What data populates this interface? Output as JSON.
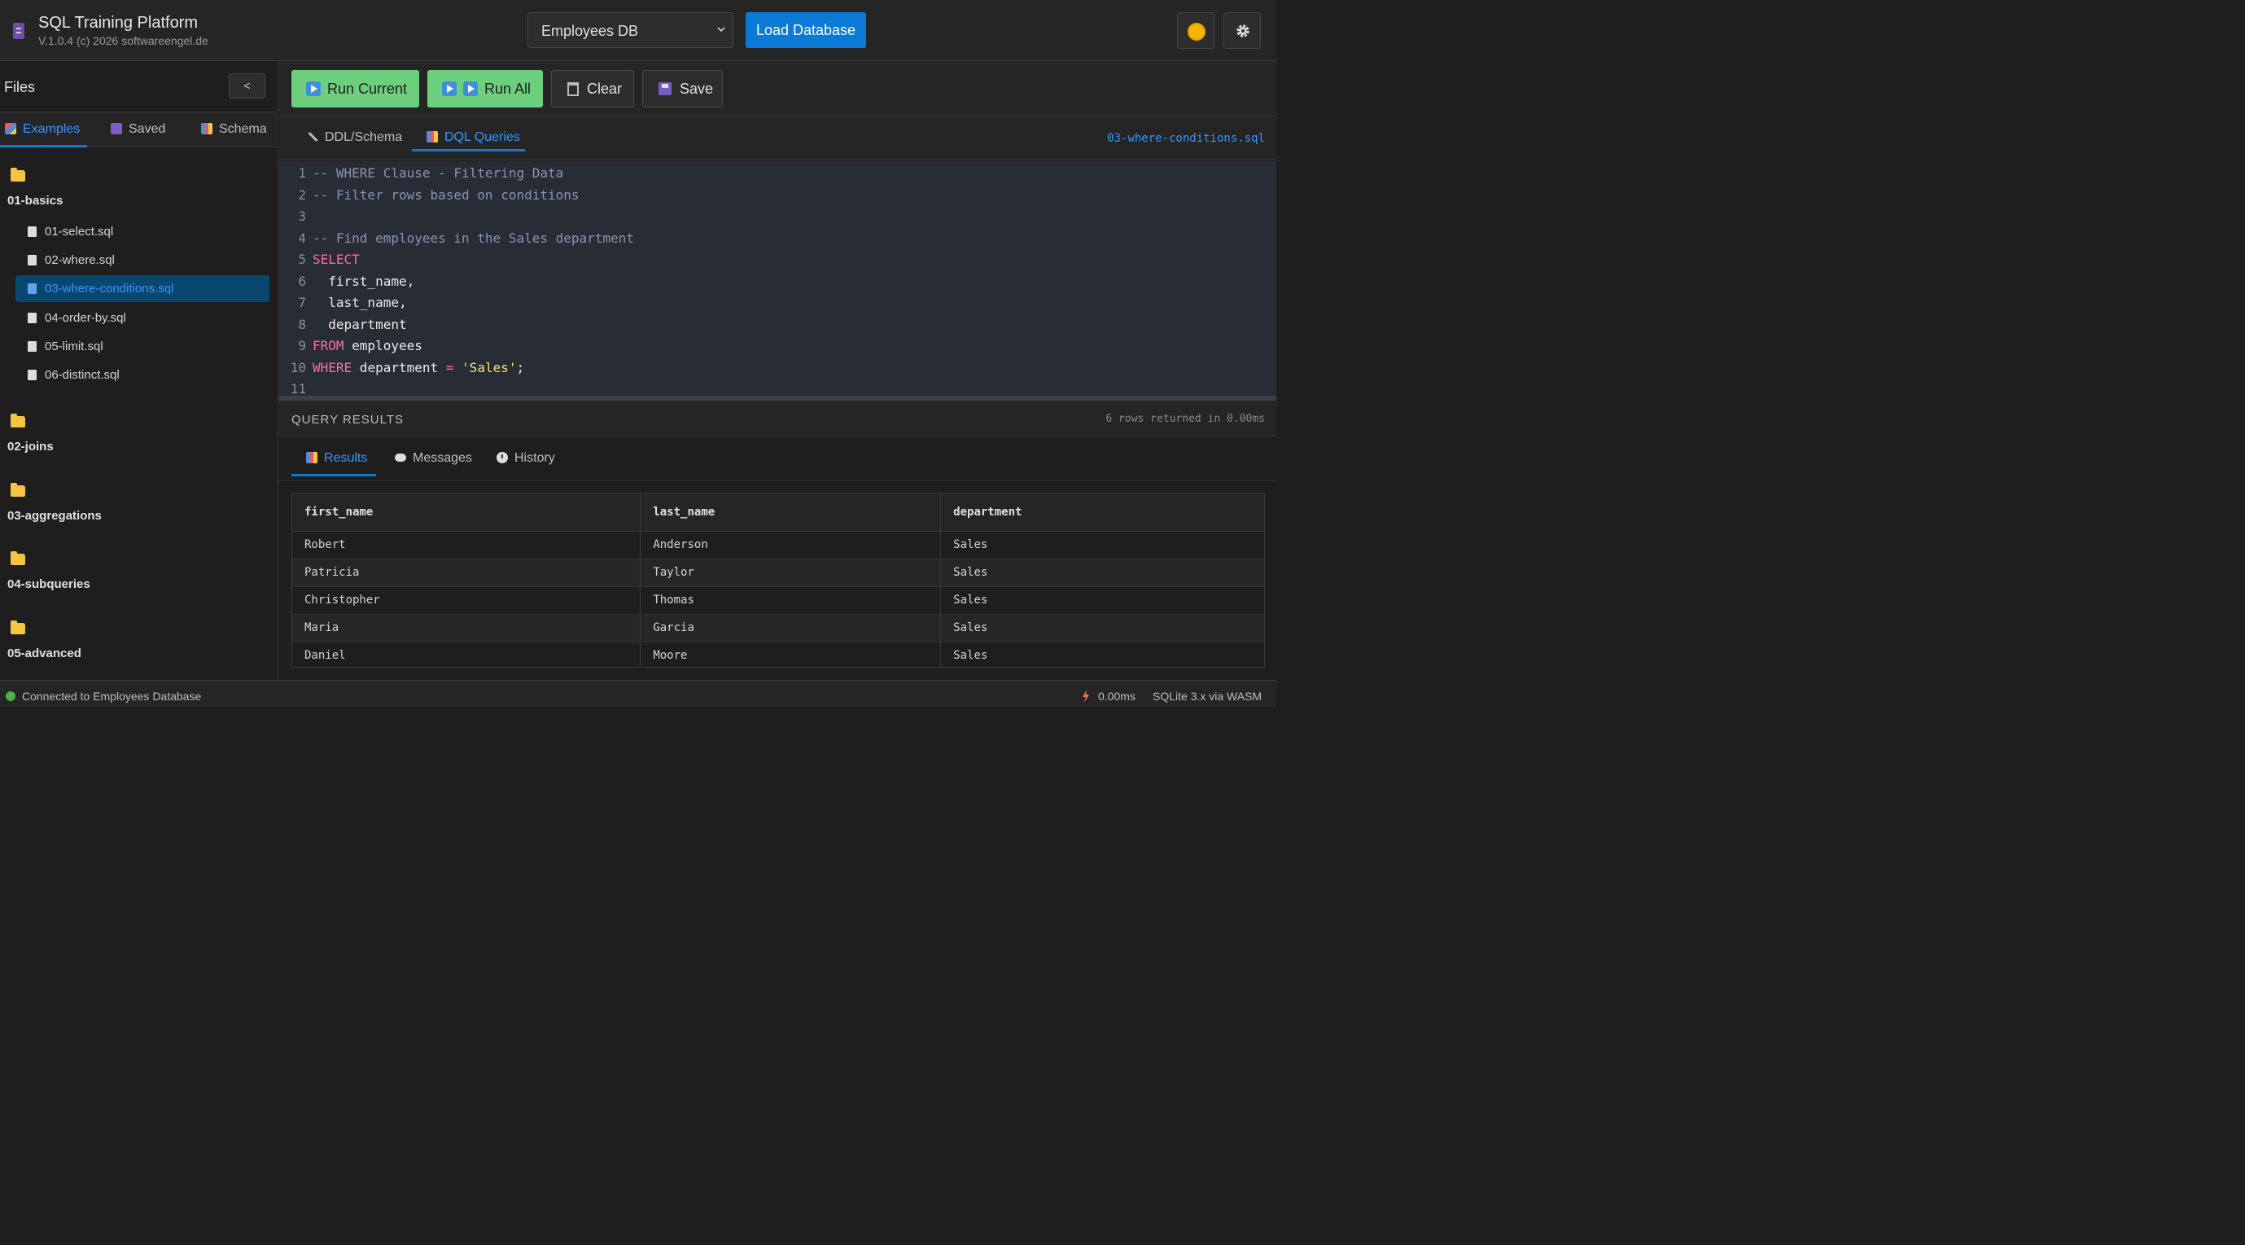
{
  "header": {
    "title": "SQL Training Platform",
    "version": "V.1.0.4 (c) 2026 softwareengel.de",
    "db_selected": "Employees DB",
    "load_label": "Load Database"
  },
  "sidebar": {
    "title": "Files",
    "collapse_label": "<",
    "tabs": [
      {
        "label": "Examples",
        "icon": "examples-icon"
      },
      {
        "label": "Saved",
        "icon": "save-icon"
      },
      {
        "label": "Schema",
        "icon": "chart-icon"
      }
    ],
    "folders": [
      {
        "label": "01-basics",
        "files": [
          "01-select.sql",
          "02-where.sql",
          "03-where-conditions.sql",
          "04-order-by.sql",
          "05-limit.sql",
          "06-distinct.sql"
        ]
      },
      {
        "label": "02-joins"
      },
      {
        "label": "03-aggregations"
      },
      {
        "label": "04-subqueries"
      },
      {
        "label": "05-advanced"
      }
    ],
    "active_file": "03-where-conditions.sql"
  },
  "toolbar": {
    "run_current": "Run Current",
    "run_all": "Run All",
    "clear": "Clear",
    "save": "Save"
  },
  "editor": {
    "tabs": [
      {
        "label": "DDL/Schema",
        "icon": "wrench-icon"
      },
      {
        "label": "DQL Queries",
        "icon": "chart-icon"
      }
    ],
    "current_file": "03-where-conditions.sql",
    "lines": [
      {
        "n": "1",
        "parts": [
          [
            "comment",
            "-- WHERE Clause - Filtering Data"
          ]
        ]
      },
      {
        "n": "2",
        "parts": [
          [
            "comment",
            "-- Filter rows based on conditions"
          ]
        ]
      },
      {
        "n": "3",
        "parts": []
      },
      {
        "n": "4",
        "parts": [
          [
            "comment",
            "-- Find employees in the Sales department"
          ]
        ]
      },
      {
        "n": "5",
        "parts": [
          [
            "kw",
            "SELECT"
          ]
        ]
      },
      {
        "n": "6",
        "parts": [
          [
            "id",
            "  first_name,"
          ]
        ]
      },
      {
        "n": "7",
        "parts": [
          [
            "id",
            "  last_name,"
          ]
        ]
      },
      {
        "n": "8",
        "parts": [
          [
            "id",
            "  department"
          ]
        ]
      },
      {
        "n": "9",
        "parts": [
          [
            "kw",
            "FROM"
          ],
          [
            "id",
            " employees"
          ]
        ]
      },
      {
        "n": "10",
        "parts": [
          [
            "kw",
            "WHERE"
          ],
          [
            "id",
            " department "
          ],
          [
            "kw",
            "="
          ],
          [
            "id",
            " "
          ],
          [
            "str",
            "'Sales'"
          ],
          [
            "id",
            ";"
          ]
        ]
      },
      {
        "n": "11",
        "parts": []
      }
    ]
  },
  "results": {
    "title": "QUERY RESULTS",
    "meta": "6 rows returned in 0.00ms",
    "tabs": [
      {
        "label": "Results",
        "icon": "chart-icon"
      },
      {
        "label": "Messages",
        "icon": "speech-bubble-icon"
      },
      {
        "label": "History",
        "icon": "clock-icon"
      }
    ],
    "columns": [
      "first_name",
      "last_name",
      "department"
    ],
    "rows": [
      [
        "Robert",
        "Anderson",
        "Sales"
      ],
      [
        "Patricia",
        "Taylor",
        "Sales"
      ],
      [
        "Christopher",
        "Thomas",
        "Sales"
      ],
      [
        "Maria",
        "Garcia",
        "Sales"
      ],
      [
        "Daniel",
        "Moore",
        "Sales"
      ]
    ]
  },
  "status": {
    "connection": "Connected to Employees Database",
    "time": "0.00ms",
    "engine": "SQLite 3.x via WASM"
  },
  "colors": {
    "accent": "#0a7ad6",
    "run_green": "#6ccf7d",
    "keyword": "#ff6aa8",
    "string": "#f1e47b",
    "comment": "#8b93b5"
  }
}
